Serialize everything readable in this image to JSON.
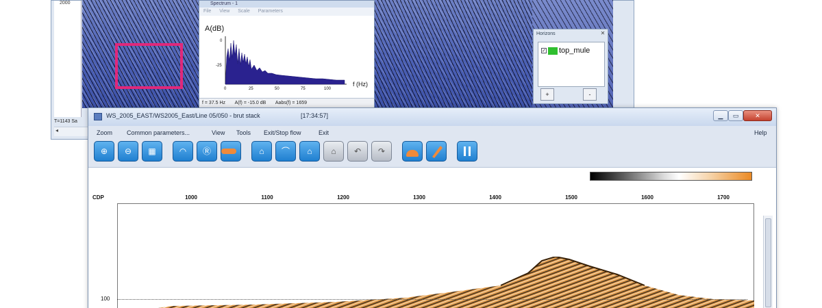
{
  "back_window": {
    "left_value": "2000",
    "status": "T=1143",
    "status2": "Sa",
    "scroll_arrow": "◂"
  },
  "spectrum": {
    "title": "Spectrum - 1",
    "menu": [
      "File",
      "View",
      "Scale",
      "Parameters"
    ],
    "y_axis_label": "A(dB)",
    "x_axis_label": "f (Hz)",
    "y_ticks": [
      "0",
      "-25"
    ],
    "x_ticks": [
      "0",
      "25",
      "50",
      "75",
      "100"
    ],
    "status": [
      "f = 37.5 Hz",
      "A(f) = -15.0 dB",
      "Aabs(f) = 1659"
    ]
  },
  "horizons": {
    "title": "Horizons",
    "items": [
      {
        "label": "top_mule",
        "checked": true,
        "color": "#2fbf2f"
      }
    ],
    "add_label": "+",
    "remove_label": "-"
  },
  "main_window": {
    "title": "WS_2005_EAST/WS2005_East/Line 05/050 - brut stack",
    "time": "[17:34:57]",
    "buttons": {
      "minimize": "▁",
      "maximize": "▭",
      "close": "✕"
    },
    "menu": [
      "Zoom",
      "Common parameters...",
      "View",
      "Tools",
      "Exit/Stop flow",
      "Exit"
    ],
    "help": "Help",
    "toolbar": [
      {
        "icon": "zoom-in-icon",
        "glyph": "⊕",
        "style": "blue"
      },
      {
        "icon": "zoom-out-icon",
        "glyph": "⊖",
        "style": "blue"
      },
      {
        "icon": "fit-view-icon",
        "glyph": "▦",
        "style": "blue"
      },
      {
        "icon": "pick-first-break-icon",
        "glyph": "◠",
        "style": "blue"
      },
      {
        "icon": "pick-horizon-icon",
        "glyph": "Ⓡ",
        "style": "blue"
      },
      {
        "icon": "pick-line-icon",
        "glyph": "▬",
        "style": "orange"
      },
      {
        "icon": "horizon-up-icon",
        "glyph": "⌂",
        "style": "blue"
      },
      {
        "icon": "horizon-curve-icon",
        "glyph": "⌒",
        "style": "blue"
      },
      {
        "icon": "horizon-pick-icon",
        "glyph": "⌂",
        "style": "blue"
      },
      {
        "icon": "horizon-delete-icon",
        "glyph": "⌂",
        "style": "gray"
      },
      {
        "icon": "undo-icon",
        "glyph": "↶",
        "style": "gray"
      },
      {
        "icon": "redo-icon",
        "glyph": "↷",
        "style": "gray"
      },
      {
        "icon": "mute-icon",
        "glyph": "◓",
        "style": "orange"
      },
      {
        "icon": "edit-icon",
        "glyph": "╱",
        "style": "orange"
      },
      {
        "icon": "pause-icon",
        "glyph": "⏸",
        "style": "blue"
      }
    ],
    "axis": {
      "x_label": "CDP",
      "x_ticks": [
        "1000",
        "1100",
        "1200",
        "1300",
        "1400",
        "1500",
        "1600",
        "1700"
      ],
      "y_tick": "100"
    },
    "colormap": {
      "low": "#000000",
      "mid": "#ffffff",
      "high": "#eb8a24"
    }
  }
}
